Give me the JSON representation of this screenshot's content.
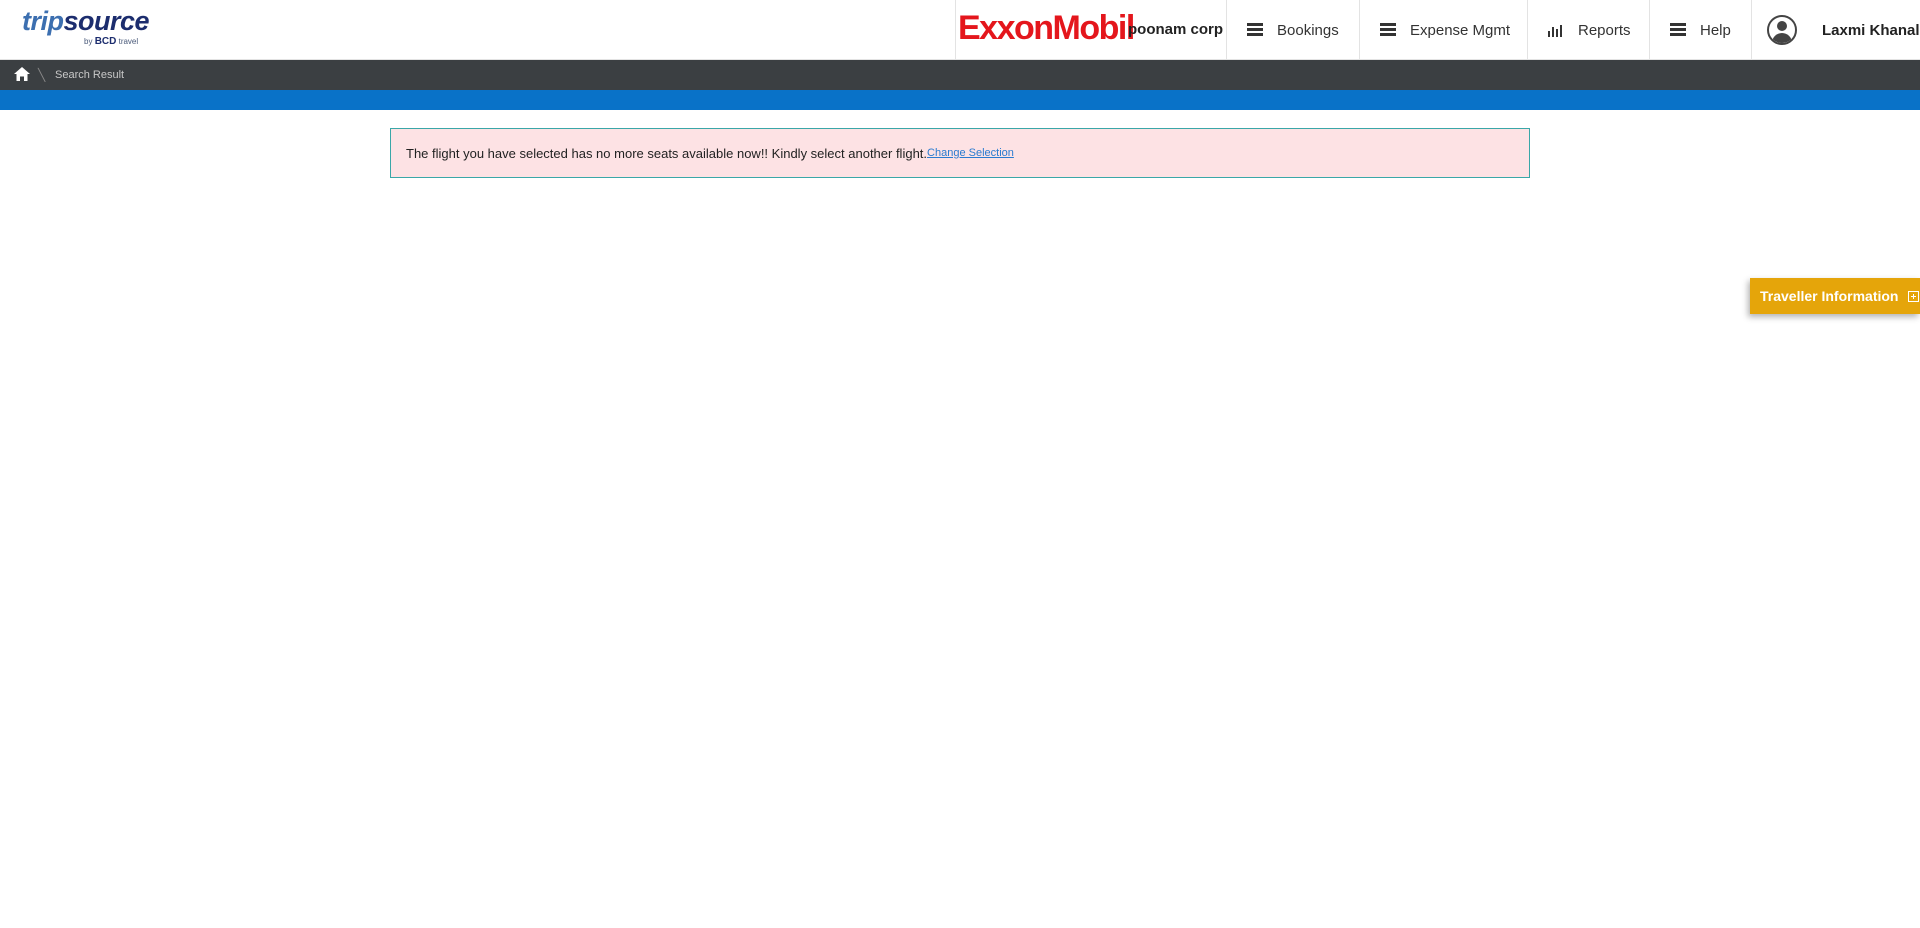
{
  "header": {
    "logo": {
      "trip": "trip",
      "source": "source",
      "by": "by",
      "bcd": "BCD",
      "travel": "travel"
    },
    "brand": {
      "company_logo": "ExxonMobil",
      "corp_name": "poonam corp"
    },
    "nav": [
      {
        "label": "Bookings",
        "icon": "menu-icon"
      },
      {
        "label": "Expense Mgmt",
        "icon": "menu-icon"
      },
      {
        "label": "Reports",
        "icon": "bar-chart-icon"
      },
      {
        "label": "Help",
        "icon": "menu-icon"
      }
    ],
    "user": {
      "name": "Laxmi Khanal",
      "icon": "user-avatar-icon"
    }
  },
  "breadcrumb": {
    "home_icon": "home-icon",
    "current": "Search Result"
  },
  "alert": {
    "message": "The flight you have selected has no more seats available now!! Kindly select another flight.",
    "link": "Change Selection"
  },
  "traveller_tab": {
    "label": "Traveller Information",
    "icon": "expand-plus-icon"
  },
  "colors": {
    "breadcrumb_bg": "#3b3f42",
    "blue_bar": "#0972c8",
    "alert_bg": "#fde2e4",
    "alert_border": "#3aa7a8",
    "traveller_tab": "#e5a50a",
    "brand_red": "#e4161c"
  }
}
